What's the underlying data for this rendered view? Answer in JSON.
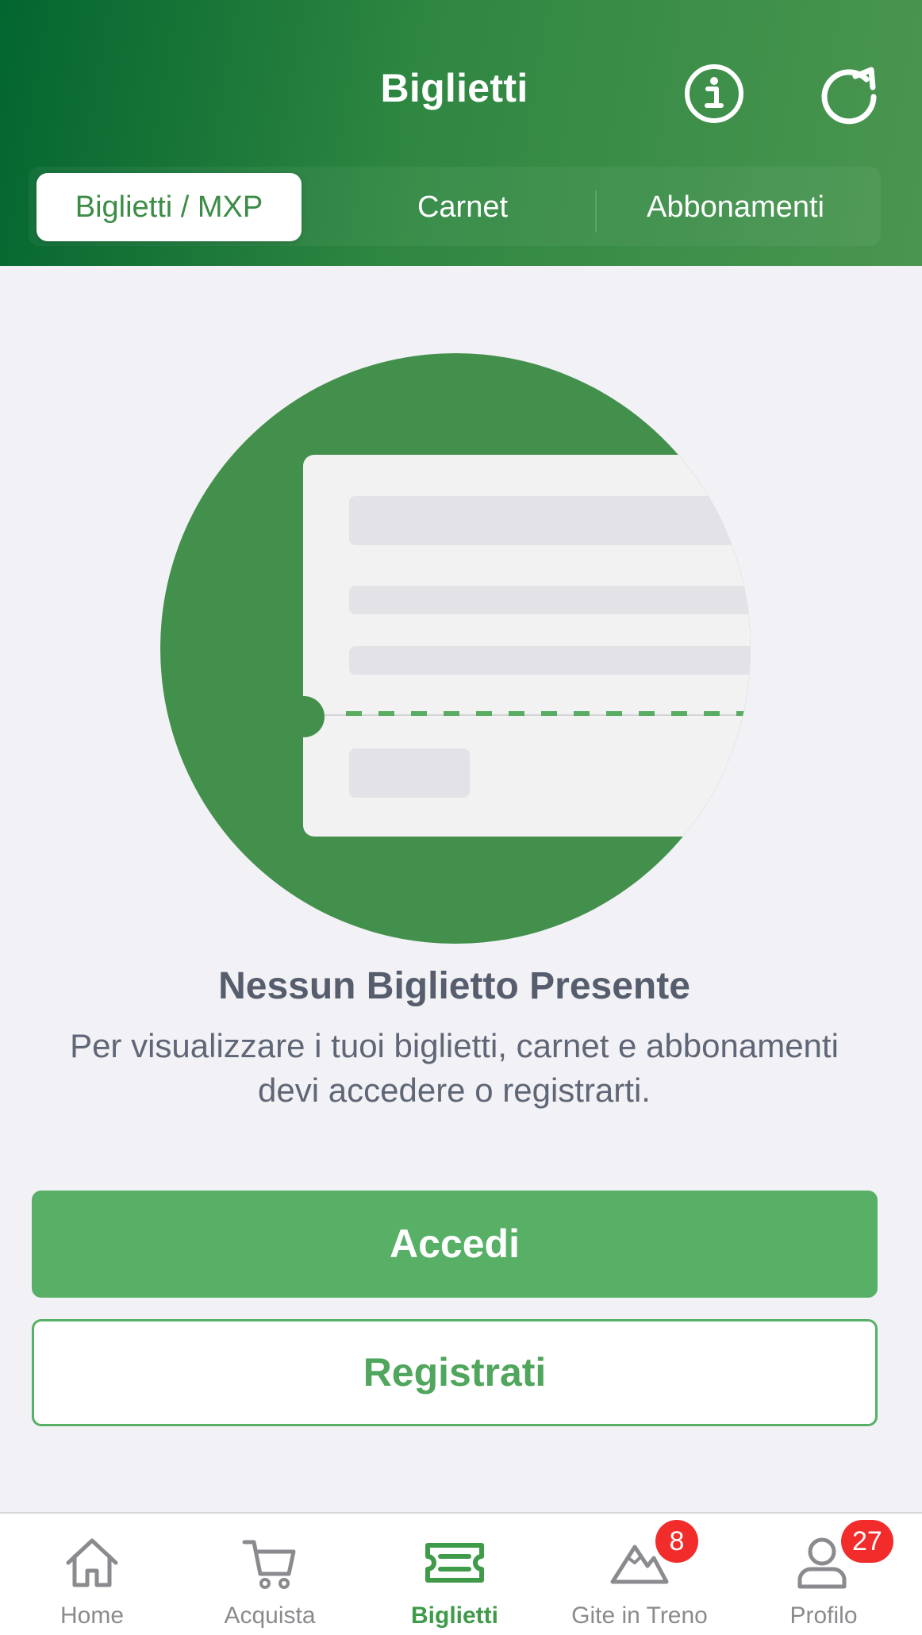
{
  "header": {
    "title": "Biglietti",
    "info_icon": "info-icon",
    "refresh_icon": "refresh-icon"
  },
  "segments": [
    {
      "label": "Biglietti / MXP",
      "active": true
    },
    {
      "label": "Carnet",
      "active": false
    },
    {
      "label": "Abbonamenti",
      "active": false
    }
  ],
  "empty_state": {
    "illustration": "ticket-illustration",
    "title": "Nessun Biglietto Presente",
    "description": "Per visualizzare i tuoi biglietti, carnet e abbonamenti devi accedere o registrarti."
  },
  "actions": {
    "login_label": "Accedi",
    "register_label": "Registrati"
  },
  "tabbar": {
    "items": [
      {
        "label": "Home",
        "icon": "home-icon",
        "active": false,
        "badge": ""
      },
      {
        "label": "Acquista",
        "icon": "cart-icon",
        "active": false,
        "badge": ""
      },
      {
        "label": "Biglietti",
        "icon": "ticket-icon",
        "active": true,
        "badge": ""
      },
      {
        "label": "Gite in Treno",
        "icon": "mountain-icon",
        "active": false,
        "badge": "8"
      },
      {
        "label": "Profilo",
        "icon": "profile-icon",
        "active": false,
        "badge": "27"
      }
    ]
  },
  "colors": {
    "brand_dark": "#03652f",
    "brand_green": "#57b065",
    "badge_red": "#f12c2a",
    "background": "#f1f1f6"
  }
}
